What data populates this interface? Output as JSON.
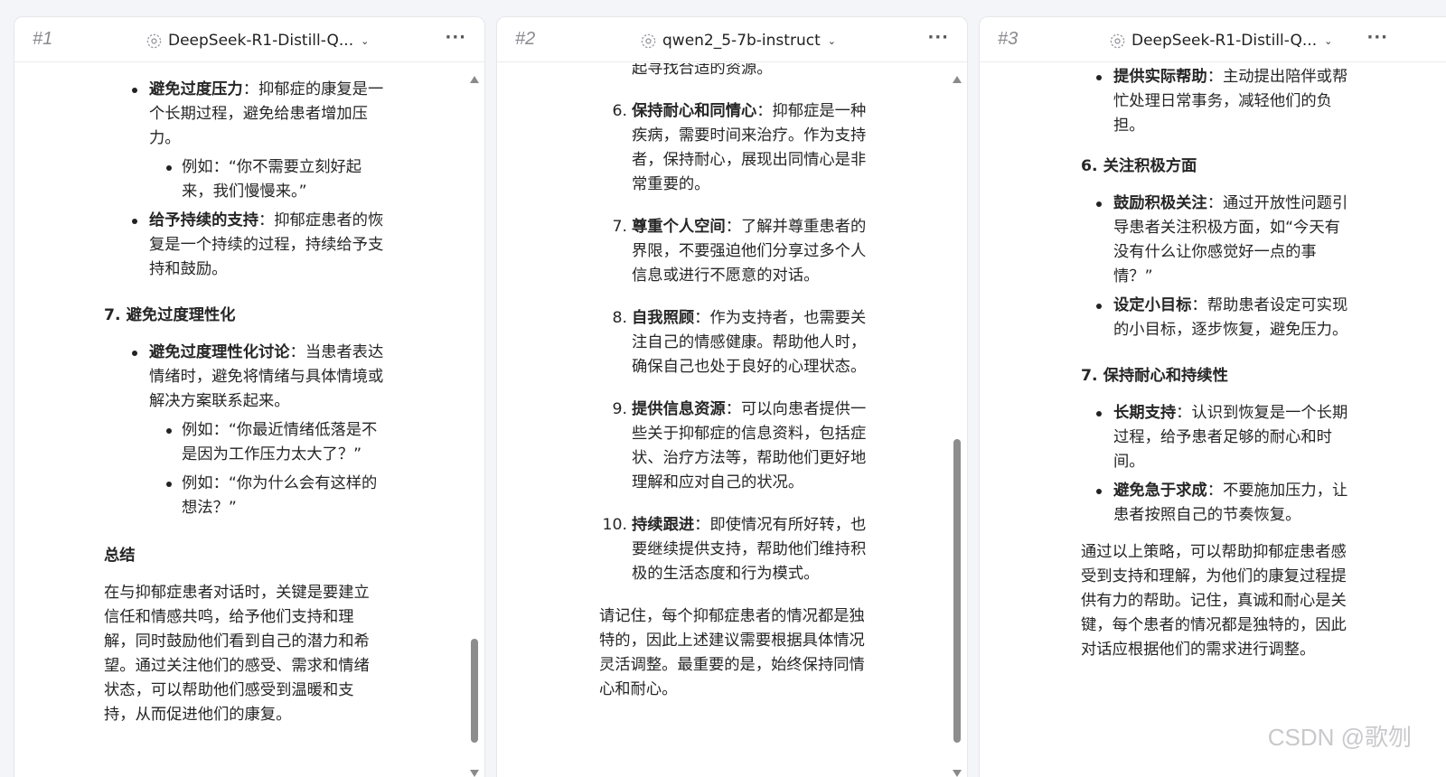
{
  "panels": [
    {
      "index": "#1",
      "model": "DeepSeek-R1-Distill-Q...",
      "more": "···"
    },
    {
      "index": "#2",
      "model": "qwen2_5-7b-instruct",
      "more": "···"
    },
    {
      "index": "#3",
      "model": "DeepSeek-R1-Distill-Q...",
      "more": "···"
    }
  ],
  "p1": {
    "b1_bold": "避免过度压力",
    "b1_text": "：抑郁症的康复是一个长期过程，避免给患者增加压力。",
    "b1_sub": "例如：“你不需要立刻好起来，我们慢慢来。”",
    "b2_bold": "给予持续的支持",
    "b2_text": "：抑郁症患者的恢复是一个持续的过程，持续给予支持和鼓励。",
    "h7": "7. 避免过度理性化",
    "b3_bold": "避免过度理性化讨论",
    "b3_text": "：当患者表达情绪时，避免将情绪与具体情境或解决方案联系起来。",
    "b3_sub1": "例如：“你最近情绪低落是不是因为工作压力太大了？”",
    "b3_sub2": "例如：“你为什么会有这样的想法？”",
    "summary_h": "总结",
    "summary": "在与抑郁症患者对话时，关键是要建立信任和情感共鸣，给予他们支持和理解，同时鼓励他们看到自己的潜力和希望。通过关注他们的感受、需求和情绪状态，可以帮助他们感受到温暖和支持，从而促进他们的康复。"
  },
  "p2": {
    "cut": "起寻找合适的资源。",
    "i6_n": "6.",
    "i6_bold": "保持耐心和同情心",
    "i6_text": "：抑郁症是一种疾病，需要时间来治疗。作为支持者，保持耐心，展现出同情心是非常重要的。",
    "i7_n": "7.",
    "i7_bold": "尊重个人空间",
    "i7_text": "：了解并尊重患者的界限，不要强迫他们分享过多个人信息或进行不愿意的对话。",
    "i8_n": "8.",
    "i8_bold": "自我照顾",
    "i8_text": "：作为支持者，也需要关注自己的情感健康。帮助他人时，确保自己也处于良好的心理状态。",
    "i9_n": "9.",
    "i9_bold": "提供信息资源",
    "i9_text": "：可以向患者提供一些关于抑郁症的信息资料，包括症状、治疗方法等，帮助他们更好地理解和应对自己的状况。",
    "i10_n": "10.",
    "i10_bold": "持续跟进",
    "i10_text": "：即使情况有所好转，也要继续提供支持，帮助他们维持积极的生活态度和行为模式。",
    "closing": "请记住，每个抑郁症患者的情况都是独特的，因此上述建议需要根据具体情况灵活调整。最重要的是，始终保持同情心和耐心。"
  },
  "p3": {
    "b1_bold": "提供实际帮助",
    "b1_text": "：主动提出陪伴或帮忙处理日常事务，减轻他们的负担。",
    "h6": "6. 关注积极方面",
    "b2_bold": "鼓励积极关注",
    "b2_text": "：通过开放性问题引导患者关注积极方面，如“今天有没有什么让你感觉好一点的事情？”",
    "b3_bold": "设定小目标",
    "b3_text": "：帮助患者设定可实现的小目标，逐步恢复，避免压力。",
    "h7": "7. 保持耐心和持续性",
    "b4_bold": "长期支持",
    "b4_text": "：认识到恢复是一个长期过程，给予患者足够的耐心和时间。",
    "b5_bold": "避免急于求成",
    "b5_text": "：不要施加压力，让患者按照自己的节奏恢复。",
    "closing": "通过以上策略，可以帮助抑郁症患者感受到支持和理解，为他们的康复过程提供有力的帮助。记住，真诚和耐心是关键，每个患者的情况都是独特的，因此对话应根据他们的需求进行调整。"
  },
  "watermark": "CSDN @歌刎"
}
